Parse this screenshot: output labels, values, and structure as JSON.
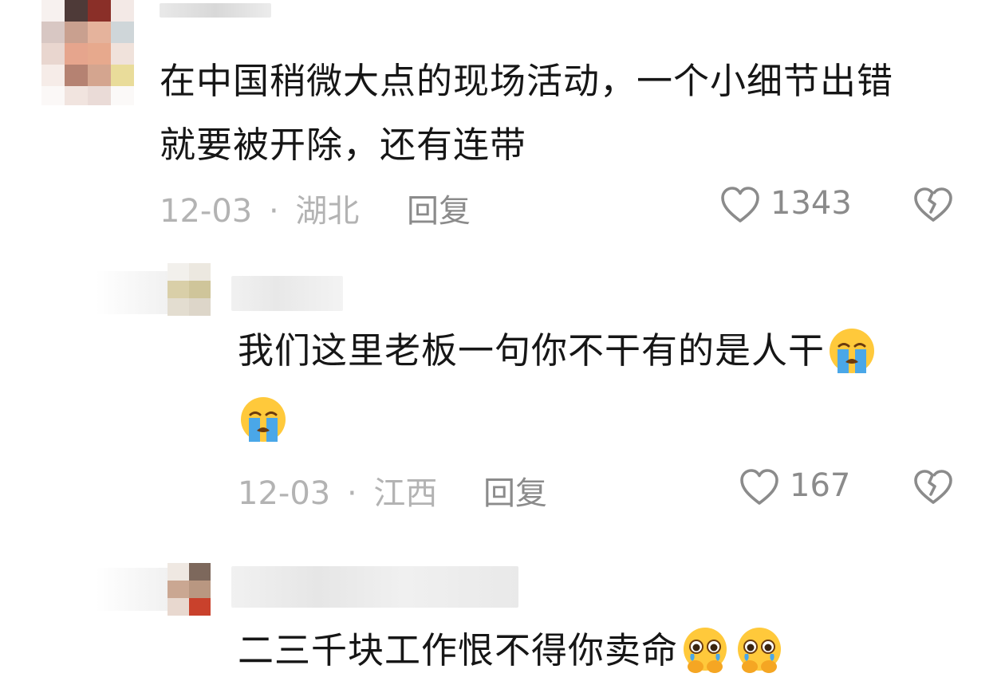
{
  "comments": [
    {
      "text_lines": [
        "在中国稍微大点的现场活动，一个小细节出错",
        "就要被开除，还有连带"
      ],
      "date": "12-03",
      "separator": "·",
      "location": "湖北",
      "reply_label": "回复",
      "likes": "1343"
    },
    {
      "text_lines": [
        "我们这里老板一句你不干有的是人干",
        ""
      ],
      "emojis_line1": [
        "loudly-crying-face"
      ],
      "emojis_line2": [
        "loudly-crying-face"
      ],
      "date": "12-03",
      "separator": "·",
      "location": "江西",
      "reply_label": "回复",
      "likes": "167"
    },
    {
      "text_lines": [
        "二三千块工作恨不得你卖命"
      ],
      "emojis_line1": [
        "face-holding-back-tears",
        "face-holding-back-tears"
      ]
    }
  ],
  "colors": {
    "text": "#161616",
    "meta": "#b3b3b3",
    "action": "#8b8b8b",
    "background": "#ffffff"
  }
}
